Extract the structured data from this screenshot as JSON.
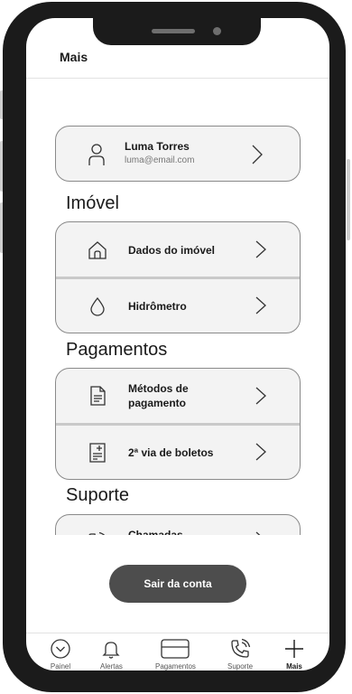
{
  "header": {
    "title": "Mais"
  },
  "profile": {
    "name": "Luma Torres",
    "email": "luma@email.com",
    "icon": "person-icon"
  },
  "sections": [
    {
      "title": "Imóvel",
      "items": [
        {
          "label": "Dados do imóvel",
          "icon": "house-icon"
        },
        {
          "label": "Hidrômetro",
          "icon": "water-drop-icon"
        }
      ]
    },
    {
      "title": "Pagamentos",
      "items": [
        {
          "label": "Métodos de pagamento",
          "icon": "document-icon"
        },
        {
          "label": "2ª via de boletos",
          "icon": "invoice-icon"
        }
      ]
    },
    {
      "title": "Suporte",
      "items": [
        {
          "label": "Chamadas anteriores",
          "icon": "phone-call-icon"
        }
      ]
    }
  ],
  "logout_label": "Sair da conta",
  "tabs": [
    {
      "label": "Painel",
      "icon": "chevron-circle-icon",
      "active": false
    },
    {
      "label": "Alertas",
      "icon": "bell-icon",
      "active": false
    },
    {
      "label": "Pagamentos",
      "icon": "card-icon",
      "active": false
    },
    {
      "label": "Suporte",
      "icon": "phone-call-icon",
      "active": false
    },
    {
      "label": "Mais",
      "icon": "plus-icon",
      "active": true
    }
  ],
  "colors": {
    "frame": "#1b1b1b",
    "card_bg": "#f3f3f3",
    "card_border": "#8a8a8a",
    "button": "#4d4d4d"
  }
}
